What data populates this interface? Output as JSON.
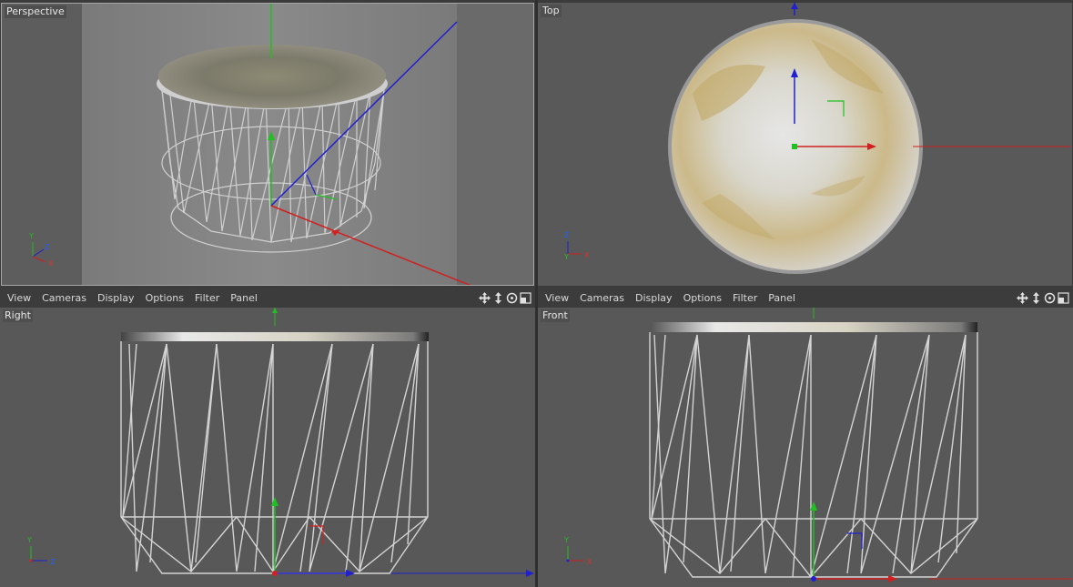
{
  "viewports": {
    "perspective": {
      "label": "Perspective"
    },
    "top": {
      "label": "Top"
    },
    "right": {
      "label": "Right"
    },
    "front": {
      "label": "Front"
    }
  },
  "menubar": {
    "items": [
      "View",
      "Cameras",
      "Display",
      "Options",
      "Filter",
      "Panel"
    ]
  },
  "axes": {
    "persp": [
      "Y",
      "Z",
      "X"
    ],
    "top": [
      "Z",
      "Y",
      "X"
    ],
    "right": [
      "Y",
      "Z"
    ],
    "front": [
      "Y",
      "X"
    ]
  },
  "colors": {
    "x_axis": "#d02020",
    "y_axis": "#20c020",
    "z_axis": "#2020d0",
    "wire": "#d6d6d6",
    "viewport_bg": "#595959"
  },
  "icons": [
    "move-view-icon",
    "pan-view-icon",
    "rotate-view-icon",
    "maximize-view-icon"
  ]
}
